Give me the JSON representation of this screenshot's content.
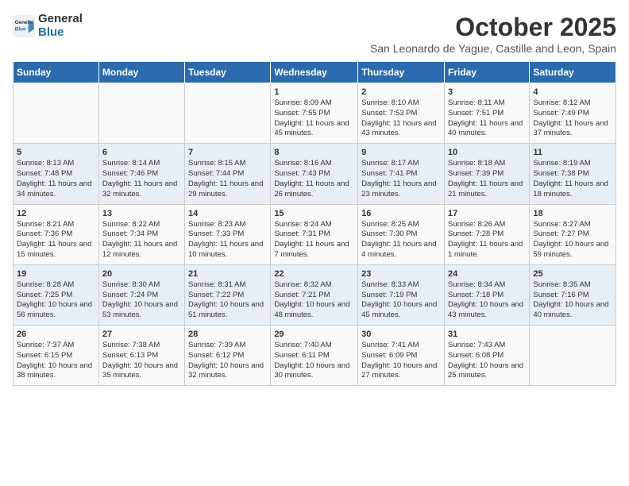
{
  "logo": {
    "line1": "General",
    "line2": "Blue"
  },
  "title": "October 2025",
  "location": "San Leonardo de Yague, Castille and Leon, Spain",
  "weekdays": [
    "Sunday",
    "Monday",
    "Tuesday",
    "Wednesday",
    "Thursday",
    "Friday",
    "Saturday"
  ],
  "weeks": [
    [
      {
        "day": "",
        "content": ""
      },
      {
        "day": "",
        "content": ""
      },
      {
        "day": "",
        "content": ""
      },
      {
        "day": "1",
        "content": "Sunrise: 8:09 AM\nSunset: 7:55 PM\nDaylight: 11 hours\nand 45 minutes."
      },
      {
        "day": "2",
        "content": "Sunrise: 8:10 AM\nSunset: 7:53 PM\nDaylight: 11 hours\nand 43 minutes."
      },
      {
        "day": "3",
        "content": "Sunrise: 8:11 AM\nSunset: 7:51 PM\nDaylight: 11 hours\nand 40 minutes."
      },
      {
        "day": "4",
        "content": "Sunrise: 8:12 AM\nSunset: 7:49 PM\nDaylight: 11 hours\nand 37 minutes."
      }
    ],
    [
      {
        "day": "5",
        "content": "Sunrise: 8:13 AM\nSunset: 7:48 PM\nDaylight: 11 hours\nand 34 minutes."
      },
      {
        "day": "6",
        "content": "Sunrise: 8:14 AM\nSunset: 7:46 PM\nDaylight: 11 hours\nand 32 minutes."
      },
      {
        "day": "7",
        "content": "Sunrise: 8:15 AM\nSunset: 7:44 PM\nDaylight: 11 hours\nand 29 minutes."
      },
      {
        "day": "8",
        "content": "Sunrise: 8:16 AM\nSunset: 7:43 PM\nDaylight: 11 hours\nand 26 minutes."
      },
      {
        "day": "9",
        "content": "Sunrise: 8:17 AM\nSunset: 7:41 PM\nDaylight: 11 hours\nand 23 minutes."
      },
      {
        "day": "10",
        "content": "Sunrise: 8:18 AM\nSunset: 7:39 PM\nDaylight: 11 hours\nand 21 minutes."
      },
      {
        "day": "11",
        "content": "Sunrise: 8:19 AM\nSunset: 7:38 PM\nDaylight: 11 hours\nand 18 minutes."
      }
    ],
    [
      {
        "day": "12",
        "content": "Sunrise: 8:21 AM\nSunset: 7:36 PM\nDaylight: 11 hours\nand 15 minutes."
      },
      {
        "day": "13",
        "content": "Sunrise: 8:22 AM\nSunset: 7:34 PM\nDaylight: 11 hours\nand 12 minutes."
      },
      {
        "day": "14",
        "content": "Sunrise: 8:23 AM\nSunset: 7:33 PM\nDaylight: 11 hours\nand 10 minutes."
      },
      {
        "day": "15",
        "content": "Sunrise: 8:24 AM\nSunset: 7:31 PM\nDaylight: 11 hours\nand 7 minutes."
      },
      {
        "day": "16",
        "content": "Sunrise: 8:25 AM\nSunset: 7:30 PM\nDaylight: 11 hours\nand 4 minutes."
      },
      {
        "day": "17",
        "content": "Sunrise: 8:26 AM\nSunset: 7:28 PM\nDaylight: 11 hours\nand 1 minute."
      },
      {
        "day": "18",
        "content": "Sunrise: 8:27 AM\nSunset: 7:27 PM\nDaylight: 10 hours\nand 59 minutes."
      }
    ],
    [
      {
        "day": "19",
        "content": "Sunrise: 8:28 AM\nSunset: 7:25 PM\nDaylight: 10 hours\nand 56 minutes."
      },
      {
        "day": "20",
        "content": "Sunrise: 8:30 AM\nSunset: 7:24 PM\nDaylight: 10 hours\nand 53 minutes."
      },
      {
        "day": "21",
        "content": "Sunrise: 8:31 AM\nSunset: 7:22 PM\nDaylight: 10 hours\nand 51 minutes."
      },
      {
        "day": "22",
        "content": "Sunrise: 8:32 AM\nSunset: 7:21 PM\nDaylight: 10 hours\nand 48 minutes."
      },
      {
        "day": "23",
        "content": "Sunrise: 8:33 AM\nSunset: 7:19 PM\nDaylight: 10 hours\nand 45 minutes."
      },
      {
        "day": "24",
        "content": "Sunrise: 8:34 AM\nSunset: 7:18 PM\nDaylight: 10 hours\nand 43 minutes."
      },
      {
        "day": "25",
        "content": "Sunrise: 8:35 AM\nSunset: 7:16 PM\nDaylight: 10 hours\nand 40 minutes."
      }
    ],
    [
      {
        "day": "26",
        "content": "Sunrise: 7:37 AM\nSunset: 6:15 PM\nDaylight: 10 hours\nand 38 minutes."
      },
      {
        "day": "27",
        "content": "Sunrise: 7:38 AM\nSunset: 6:13 PM\nDaylight: 10 hours\nand 35 minutes."
      },
      {
        "day": "28",
        "content": "Sunrise: 7:39 AM\nSunset: 6:12 PM\nDaylight: 10 hours\nand 32 minutes."
      },
      {
        "day": "29",
        "content": "Sunrise: 7:40 AM\nSunset: 6:11 PM\nDaylight: 10 hours\nand 30 minutes."
      },
      {
        "day": "30",
        "content": "Sunrise: 7:41 AM\nSunset: 6:09 PM\nDaylight: 10 hours\nand 27 minutes."
      },
      {
        "day": "31",
        "content": "Sunrise: 7:43 AM\nSunset: 6:08 PM\nDaylight: 10 hours\nand 25 minutes."
      },
      {
        "day": "",
        "content": ""
      }
    ]
  ]
}
